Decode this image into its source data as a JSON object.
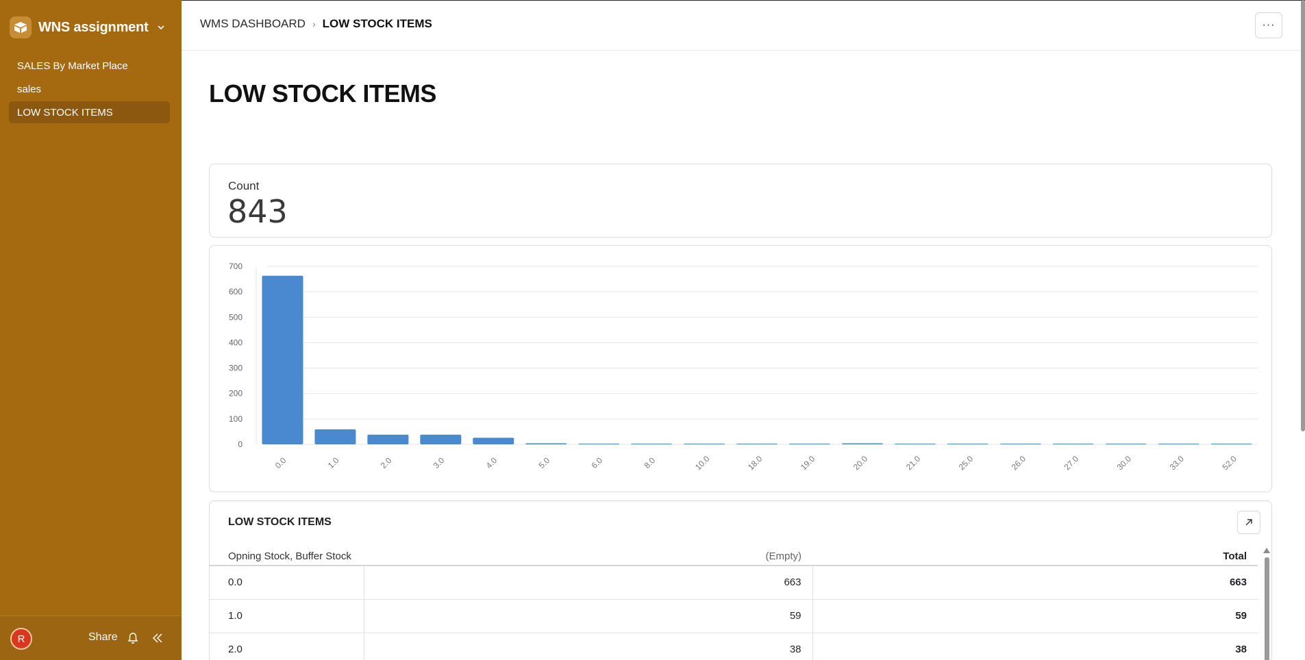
{
  "workspace": {
    "title": "WNS assignment"
  },
  "sidebar": {
    "items": [
      {
        "label": "SALES By Market Place"
      },
      {
        "label": "sales"
      },
      {
        "label": "LOW STOCK ITEMS"
      }
    ],
    "footer": {
      "avatar_initial": "R",
      "share_label": "Share"
    }
  },
  "breadcrumb": {
    "parent": "WMS DASHBOARD",
    "separator": "›",
    "current": "LOW STOCK ITEMS"
  },
  "topbar": {
    "more_label": "···"
  },
  "page": {
    "title": "LOW STOCK ITEMS"
  },
  "count_card": {
    "label": "Count",
    "value": "843"
  },
  "chart_data": {
    "type": "bar",
    "categories": [
      "0.0",
      "1.0",
      "2.0",
      "3.0",
      "4.0",
      "5.0",
      "6.0",
      "8.0",
      "10.0",
      "18.0",
      "19.0",
      "20.0",
      "21.0",
      "25.0",
      "26.0",
      "27.0",
      "30.0",
      "33.0",
      "52.0"
    ],
    "values": [
      663,
      59,
      38,
      38,
      26,
      4,
      1,
      1,
      1,
      1,
      1,
      4,
      2,
      1,
      1,
      1,
      1,
      1,
      1
    ],
    "ylim": [
      0,
      700
    ],
    "yticks": [
      "0",
      "100",
      "200",
      "300",
      "400",
      "500",
      "600",
      "700"
    ],
    "ytick_values": [
      0,
      100,
      200,
      300,
      400,
      500,
      600,
      700
    ],
    "color": "#4a88d0",
    "grid": true
  },
  "table": {
    "title": "LOW STOCK ITEMS",
    "headers": {
      "dimension": "Opning Stock, Buffer Stock",
      "empty": "(Empty)",
      "total": "Total"
    },
    "rows": [
      {
        "dim": "0.0",
        "empty": "663",
        "total": "663"
      },
      {
        "dim": "1.0",
        "empty": "59",
        "total": "59"
      },
      {
        "dim": "2.0",
        "empty": "38",
        "total": "38"
      }
    ]
  },
  "colors": {
    "sidebar": "#a56a10",
    "bar": "#4a88d0"
  }
}
